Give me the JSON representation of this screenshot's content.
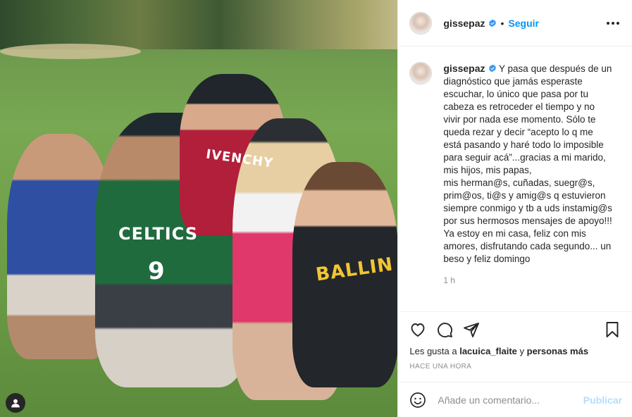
{
  "post": {
    "username": "gissepaz",
    "follow_label": "Seguir",
    "dot": "•",
    "caption_username": "gissepaz",
    "caption_text": "Y pasa que después de un diagnóstico que jamás esperaste escuchar, lo único que pasa por tu cabeza es retroceder el tiempo y no vivir por nada ese momento. Sólo te queda rezar y decir “acepto lo q me está pasando y haré todo lo imposible para seguir acá”...gracias a mi marido, mis hijos, mis papas,\nmis herman@s, cuñadas, suegr@s, prim@os, ti@s y amig@s q estuvieron siempre conmigo y tb a uds instamig@s por sus hermosos mensajes de apoyo!!! Ya estoy en mi casa, feliz con mis amores, disfrutando cada segundo... un beso y feliz domingo",
    "time_ago": "1 h",
    "likes_prefix": "Les gusta a",
    "likes_user": "lacuica_flaite",
    "likes_and": "y",
    "likes_others": "personas más",
    "posted": "HACE UNA HORA"
  },
  "photo": {
    "shirt_celtics": "CELTICS",
    "shirt_number": "9",
    "shirt_givenchy": "IVENCHY",
    "shirt_ballin": "BALLIN"
  },
  "comment_box": {
    "placeholder": "Añade un comentario...",
    "publish_label": "Publicar"
  },
  "icons": {
    "more": "more-options-icon",
    "like": "heart-icon",
    "comment": "comment-icon",
    "share": "share-icon",
    "save": "bookmark-icon",
    "emoji": "emoji-icon",
    "verified": "verified-badge-icon",
    "user_tag": "user-tag-icon"
  },
  "colors": {
    "follow": "#0095f6",
    "verified": "#3897f0",
    "publish_disabled": "#b2dffc",
    "secondary_text": "#8e8e8e"
  }
}
